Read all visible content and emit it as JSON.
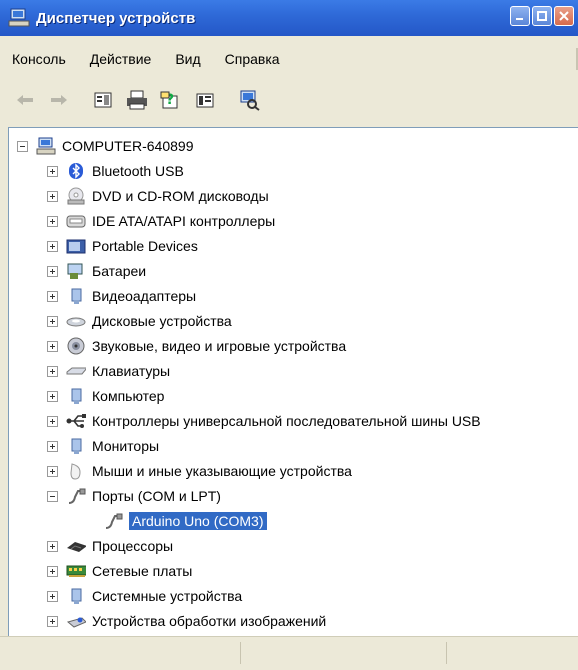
{
  "window": {
    "title": "Диспетчер устройств"
  },
  "menu": {
    "items": [
      "Консоль",
      "Действие",
      "Вид",
      "Справка"
    ]
  },
  "toolbar": {
    "buttons": [
      "back-icon",
      "forward-icon",
      "properties-icon",
      "print-icon",
      "help-icon",
      "view-icon",
      "scan-hardware-icon"
    ]
  },
  "tree": {
    "root": {
      "label": "COMPUTER-640899",
      "icon": "computer-icon"
    },
    "items": [
      {
        "label": "Bluetooth USB",
        "icon": "bluetooth-icon",
        "state": "collapsed"
      },
      {
        "label": "DVD и CD-ROM дисководы",
        "icon": "cdrom-icon",
        "state": "collapsed"
      },
      {
        "label": "IDE ATA/ATAPI контроллеры",
        "icon": "ide-icon",
        "state": "collapsed"
      },
      {
        "label": "Portable Devices",
        "icon": "portable-device-icon",
        "state": "collapsed"
      },
      {
        "label": "Батареи",
        "icon": "battery-icon",
        "state": "collapsed"
      },
      {
        "label": "Видеоадаптеры",
        "icon": "display-adapter-icon",
        "state": "collapsed"
      },
      {
        "label": "Дисковые устройства",
        "icon": "disk-drive-icon",
        "state": "collapsed"
      },
      {
        "label": "Звуковые, видео и игровые устройства",
        "icon": "sound-icon",
        "state": "collapsed"
      },
      {
        "label": "Клавиатуры",
        "icon": "keyboard-icon",
        "state": "collapsed"
      },
      {
        "label": "Компьютер",
        "icon": "computer-small-icon",
        "state": "collapsed"
      },
      {
        "label": "Контроллеры универсальной последовательной шины USB",
        "icon": "usb-icon",
        "state": "collapsed"
      },
      {
        "label": "Мониторы",
        "icon": "monitor-icon",
        "state": "collapsed"
      },
      {
        "label": "Мыши и иные указывающие устройства",
        "icon": "mouse-icon",
        "state": "collapsed"
      },
      {
        "label": "Порты (COM и LPT)",
        "icon": "port-icon",
        "state": "expanded"
      },
      {
        "label": "Arduino Uno (COM3)",
        "icon": "port-icon",
        "state": "child-selected"
      },
      {
        "label": "Процессоры",
        "icon": "processor-icon",
        "state": "collapsed"
      },
      {
        "label": "Сетевые платы",
        "icon": "network-icon",
        "state": "collapsed"
      },
      {
        "label": "Системные устройства",
        "icon": "system-icon",
        "state": "collapsed"
      },
      {
        "label": "Устройства обработки изображений",
        "icon": "imaging-icon",
        "state": "collapsed"
      }
    ]
  },
  "colors": {
    "titlebar": "#2f6ad8",
    "selection": "#316ac5",
    "chrome": "#ece9d8"
  }
}
